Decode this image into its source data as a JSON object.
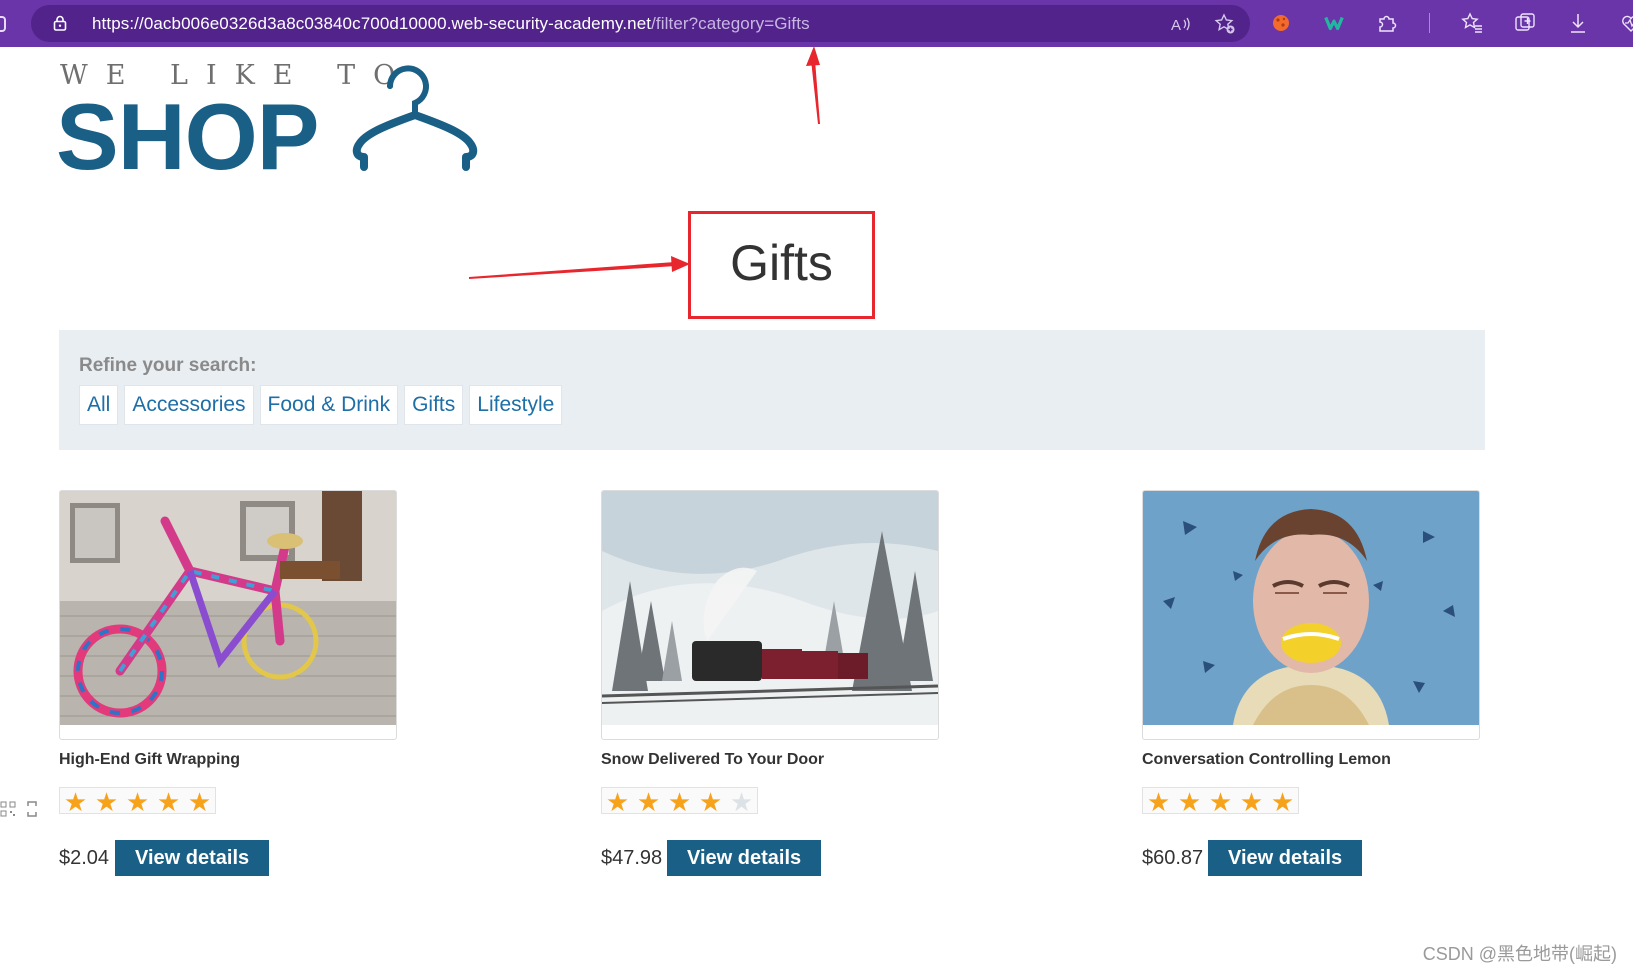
{
  "browser": {
    "url_main": "https://0acb006e0326d3a8c03840c700d10000.web-security-academy.net",
    "url_path": "/filter?category=Gifts"
  },
  "logo": {
    "tagline": "WE LIKE TO",
    "brand": "SHOP"
  },
  "page": {
    "heading": "Gifts"
  },
  "filters": {
    "label": "Refine your search:",
    "items": [
      "All",
      "Accessories",
      "Food & Drink",
      "Gifts",
      "Lifestyle"
    ]
  },
  "products": [
    {
      "name": "High-End Gift Wrapping",
      "rating": 5,
      "price": "$2.04",
      "button": "View details"
    },
    {
      "name": "Snow Delivered To Your Door",
      "rating": 4,
      "price": "$47.98",
      "button": "View details"
    },
    {
      "name": "Conversation Controlling Lemon",
      "rating": 5,
      "price": "$60.87",
      "button": "View details"
    }
  ],
  "colors": {
    "browser_bar": "#6a35a8",
    "brand_blue": "#1a5f85",
    "link_blue": "#1e6ea7",
    "annotation_red": "#e8262e",
    "star_on": "#f7a21b"
  },
  "watermark": "CSDN @黑色地带(崛起)"
}
